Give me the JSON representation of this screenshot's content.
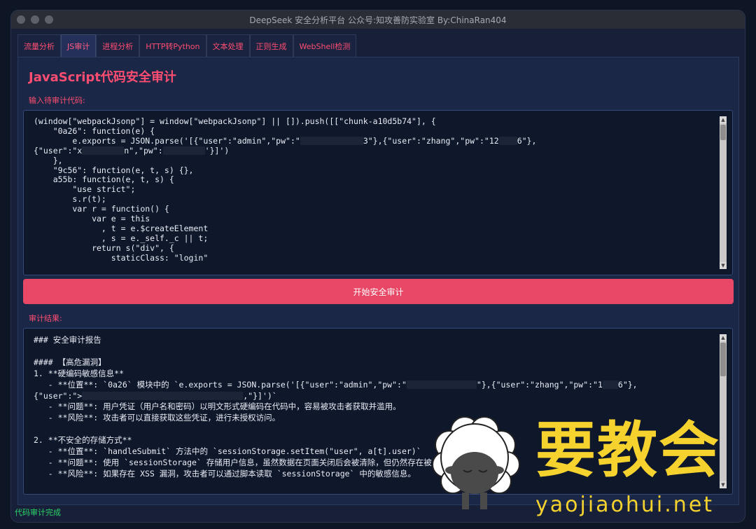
{
  "window": {
    "title": "DeepSeek 安全分析平台 公众号:知攻善防实验室 By:ChinaRan404"
  },
  "tabs": [
    {
      "label": "流量分析"
    },
    {
      "label": "JS审计"
    },
    {
      "label": "进程分析"
    },
    {
      "label": "HTTP转Python"
    },
    {
      "label": "文本处理"
    },
    {
      "label": "正则生成"
    },
    {
      "label": "WebShell检测"
    }
  ],
  "main": {
    "title": "JavaScript代码安全审计",
    "input_label": "输入待审计代码:",
    "code_lines": [
      "(window[\"webpackJsonp\"] = window[\"webpackJsonp\"] || []).push([[\"chunk-a10d5b74\"], {",
      "    \"0a26\": function(e) {",
      "        e.exports = JSON.parse('[{\"user\":\"admin\",\"pw\":\"",
      "{\"user\":\"x",
      "    },",
      "    \"9c56\": function(e, t, s) {},",
      "    a55b: function(e, t, s) {",
      "        \"use strict\";",
      "        s.r(t);",
      "        var r = function() {",
      "            var e = this",
      "              , t = e.$createElement",
      "              , s = e._self._c || t;",
      "            return s(\"div\", {",
      "                staticClass: \"login\""
    ],
    "code_fragments": {
      "l3_mid": "3\"},{\"user\":\"zhang\",\"pw\":\"12",
      "l3_end": "6\"},",
      "l4_mid": "n\",\"pw\":",
      "l4_end": "'}]')"
    },
    "audit_button": "开始安全审计",
    "result_label": "审计结果:",
    "result_lines": [
      "### 安全审计报告",
      "",
      "#### 【高危漏洞】",
      "1. **硬编码敏感信息**",
      "   - **位置**: `0a26` 模块中的 `e.exports = JSON.parse('[{\"user\":\"admin\",\"pw\":\"",
      "{\"user\":\">",
      "   - **问题**: 用户凭证（用户名和密码）以明文形式硬编码在代码中，容易被攻击者获取并滥用。",
      "   - **风险**: 攻击者可以直接获取这些凭证，进行未授权访问。",
      "",
      "2. **不安全的存储方式**",
      "   - **位置**: `handleSubmit` 方法中的 `sessionStorage.setItem(\"user\", a[t].user)`",
      "   - **问题**: 使用 `sessionStorage` 存储用户信息，虽然数据在页面关闭后会被清除，但仍然存在被 XSS 攻击窃取的风险。",
      "   - **风险**: 如果存在 XSS 漏洞，攻击者可以通过脚本读取 `sessionStorage` 中的敏感信息。"
    ],
    "result_fragments": {
      "r5_mid": "\"},{\"user\":\"zhang\",\"pw\":\"1",
      "r5_end": "6\"},",
      "r6_end": ",\"}]')`"
    }
  },
  "status": {
    "text": "代码审计完成",
    "color": "#2bd46a"
  },
  "watermark": {
    "text": "要教会",
    "url": "yaojiaohui.net"
  },
  "colors": {
    "accent": "#ff4d72",
    "button": "#e84766",
    "background": "#172038"
  }
}
